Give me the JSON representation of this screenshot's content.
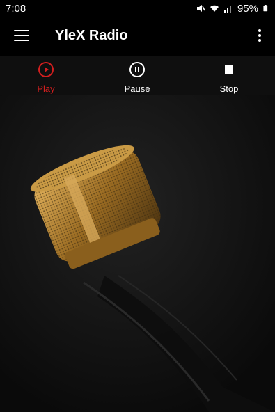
{
  "status_bar": {
    "time": "7:08",
    "battery": "95%"
  },
  "app_bar": {
    "title": "YleX Radio"
  },
  "controls": [
    {
      "label": "Play",
      "icon": "play-circle-icon",
      "color": "#d41f1f",
      "active": true
    },
    {
      "label": "Pause",
      "icon": "pause-circle-icon",
      "color": "#ffffff",
      "active": false
    },
    {
      "label": "Stop",
      "icon": "stop-icon",
      "color": "#ffffff",
      "active": false
    }
  ],
  "background": {
    "subject": "microphone"
  },
  "colors": {
    "accent": "#d41f1f",
    "bar": "#000000",
    "gold": "#b8892f"
  }
}
